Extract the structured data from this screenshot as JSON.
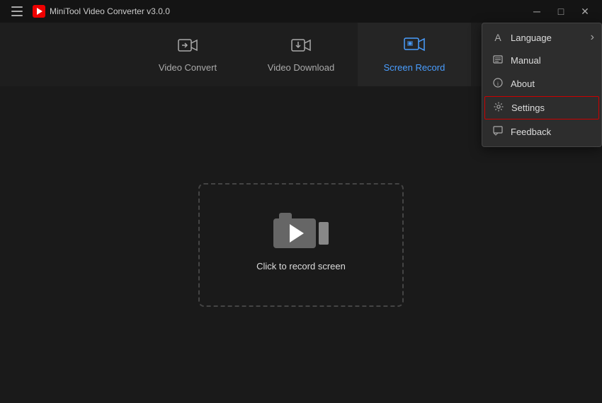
{
  "app": {
    "title": "MiniTool Video Converter v3.0.0"
  },
  "titlebar": {
    "menu_label": "☰",
    "minimize_label": "─",
    "maximize_label": "□",
    "close_label": "✕"
  },
  "nav": {
    "tabs": [
      {
        "id": "video-convert",
        "label": "Video Convert",
        "active": false
      },
      {
        "id": "video-download",
        "label": "Video Download",
        "active": false
      },
      {
        "id": "screen-record",
        "label": "Screen Record",
        "active": true
      }
    ]
  },
  "main": {
    "record_cta": "Click to record screen"
  },
  "dropdown": {
    "items": [
      {
        "id": "language",
        "label": "Language",
        "has_arrow": true,
        "icon": "A"
      },
      {
        "id": "manual",
        "label": "Manual",
        "has_arrow": false,
        "icon": "≡"
      },
      {
        "id": "about",
        "label": "About",
        "has_arrow": false,
        "icon": "ℹ"
      },
      {
        "id": "settings",
        "label": "Settings",
        "has_arrow": false,
        "icon": "⚙",
        "highlighted": true
      },
      {
        "id": "feedback",
        "label": "Feedback",
        "has_arrow": false,
        "icon": "⬚"
      }
    ]
  },
  "colors": {
    "active_tab": "#4a9eff",
    "highlight_border": "#cc0000",
    "bg_main": "#1a1a1a",
    "bg_titlebar": "#141414"
  }
}
